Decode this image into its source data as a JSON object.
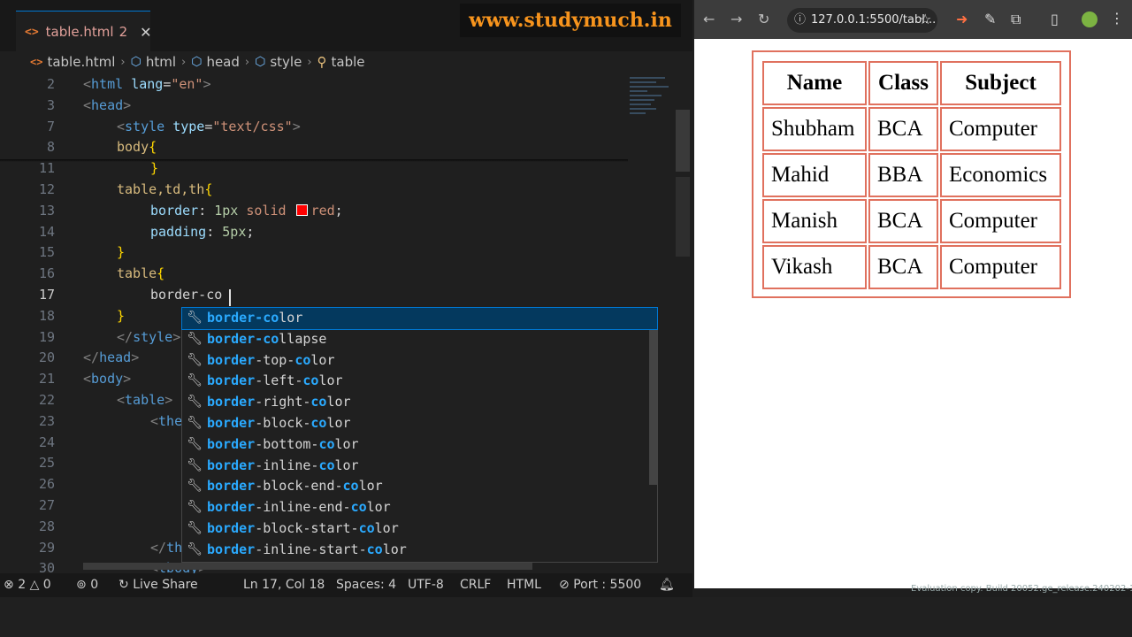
{
  "editor": {
    "tab": {
      "icon": "<>",
      "filename": "table.html",
      "problems": "2",
      "close": "✕"
    },
    "watermark": "www.studymuch.in",
    "breadcrumb": [
      "table.html",
      "html",
      "head",
      "style",
      "table"
    ],
    "code_lines": [
      {
        "n": "2",
        "text": "<html lang=\"en\">"
      },
      {
        "n": "3",
        "text": "<head>"
      },
      {
        "n": "7",
        "text": "<style type=\"text/css\">"
      },
      {
        "n": "8",
        "text": "body{"
      },
      {
        "n": "11",
        "text": "}"
      },
      {
        "n": "12",
        "text": "table,td,th{"
      },
      {
        "n": "13",
        "text": "border: 1px solid red;"
      },
      {
        "n": "14",
        "text": "padding: 5px;"
      },
      {
        "n": "15",
        "text": "}"
      },
      {
        "n": "16",
        "text": "table{"
      },
      {
        "n": "17",
        "text": "border-co"
      },
      {
        "n": "18",
        "text": "}"
      },
      {
        "n": "19",
        "text": "</style>"
      },
      {
        "n": "20",
        "text": "</head>"
      },
      {
        "n": "21",
        "text": "<body>"
      },
      {
        "n": "22",
        "text": "<table>"
      },
      {
        "n": "23",
        "text": "<thead>"
      },
      {
        "n": "24",
        "text": ""
      },
      {
        "n": "25",
        "text": ""
      },
      {
        "n": "26",
        "text": ""
      },
      {
        "n": "27",
        "text": ""
      },
      {
        "n": "28",
        "text": ""
      },
      {
        "n": "29",
        "text": "</thead>"
      },
      {
        "n": "30",
        "text": "<tbody>"
      }
    ],
    "swatch_color": "#ff0000",
    "suggestions": [
      {
        "match": "border-co",
        "rest": "lor",
        "selected": true
      },
      {
        "match": "border-co",
        "rest": "llapse"
      },
      {
        "match": "border",
        "mid": "-top-",
        "match2": "co",
        "rest": "lor"
      },
      {
        "match": "border",
        "mid": "-left-",
        "match2": "co",
        "rest": "lor"
      },
      {
        "match": "border",
        "mid": "-right-",
        "match2": "co",
        "rest": "lor"
      },
      {
        "match": "border",
        "mid": "-block-",
        "match2": "co",
        "rest": "lor"
      },
      {
        "match": "border",
        "mid": "-bottom-",
        "match2": "co",
        "rest": "lor"
      },
      {
        "match": "border",
        "mid": "-inline-",
        "match2": "co",
        "rest": "lor"
      },
      {
        "match": "border",
        "mid": "-block-end-",
        "match2": "co",
        "rest": "lor"
      },
      {
        "match": "border",
        "mid": "-inline-end-",
        "match2": "co",
        "rest": "lor"
      },
      {
        "match": "border",
        "mid": "-block-start-",
        "match2": "co",
        "rest": "lor"
      },
      {
        "match": "border",
        "mid": "-inline-start-",
        "match2": "co",
        "rest": "lor"
      }
    ],
    "statusbar": {
      "errors": "2",
      "warnings": "0",
      "ports": "0",
      "live_share": "Live Share",
      "position": "Ln 17, Col 18",
      "spaces": "Spaces: 4",
      "encoding": "UTF-8",
      "eol": "CRLF",
      "language": "HTML",
      "port": "Port : 5500"
    }
  },
  "browser": {
    "url": "127.0.0.1:5500/tabl...",
    "table": {
      "headers": [
        "Name",
        "Class",
        "Subject"
      ],
      "rows": [
        [
          "Shubham",
          "BCA",
          "Computer"
        ],
        [
          "Mahid",
          "BBA",
          "Economics"
        ],
        [
          "Manish",
          "BCA",
          "Computer"
        ],
        [
          "Vikash",
          "BCA",
          "Computer"
        ]
      ],
      "border_color": "#e0715e"
    }
  },
  "eval_note": "Evaluation copy. Build 20052.ge_release.240202-1415"
}
